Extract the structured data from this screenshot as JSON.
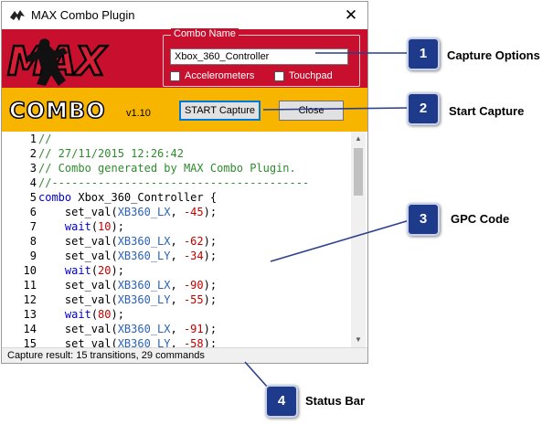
{
  "window": {
    "title": "MAX Combo Plugin",
    "close_glyph": "✕",
    "icon": "app-icon"
  },
  "header": {
    "logo_text": "MAX",
    "combo_name_legend": "Combo Name",
    "combo_name_value": "Xbox_360_Controller",
    "accelerometers_label": "Accelerometers",
    "touchpad_label": "Touchpad"
  },
  "toolbar": {
    "combo_logo_text": "COMBO",
    "version": "v1.10",
    "start_capture_label": "START Capture",
    "close_label": "Close"
  },
  "code": {
    "lines": [
      {
        "n": "1",
        "parts": [
          {
            "t": "//",
            "c": "comment"
          }
        ]
      },
      {
        "n": "2",
        "parts": [
          {
            "t": "// 27/11/2015 12:26:42",
            "c": "comment"
          }
        ]
      },
      {
        "n": "3",
        "parts": [
          {
            "t": "// Combo generated by MAX Combo Plugin.",
            "c": "comment"
          }
        ]
      },
      {
        "n": "4",
        "parts": [
          {
            "t": "//---------------------------------------",
            "c": "comment"
          }
        ]
      },
      {
        "n": "5",
        "parts": [
          {
            "t": "combo",
            "c": "kw"
          },
          {
            "t": " Xbox_360_Controller {",
            "c": "plain"
          }
        ]
      },
      {
        "n": "6",
        "parts": [
          {
            "t": "    set_val(",
            "c": "plain"
          },
          {
            "t": "XB360_LX",
            "c": "const"
          },
          {
            "t": ", ",
            "c": "plain"
          },
          {
            "t": "-45",
            "c": "num"
          },
          {
            "t": ");",
            "c": "plain"
          }
        ]
      },
      {
        "n": "7",
        "parts": [
          {
            "t": "    ",
            "c": "plain"
          },
          {
            "t": "wait",
            "c": "kw"
          },
          {
            "t": "(",
            "c": "plain"
          },
          {
            "t": "10",
            "c": "num"
          },
          {
            "t": ");",
            "c": "plain"
          }
        ]
      },
      {
        "n": "8",
        "parts": [
          {
            "t": "    set_val(",
            "c": "plain"
          },
          {
            "t": "XB360_LX",
            "c": "const"
          },
          {
            "t": ", ",
            "c": "plain"
          },
          {
            "t": "-62",
            "c": "num"
          },
          {
            "t": ");",
            "c": "plain"
          }
        ]
      },
      {
        "n": "9",
        "parts": [
          {
            "t": "    set_val(",
            "c": "plain"
          },
          {
            "t": "XB360_LY",
            "c": "const"
          },
          {
            "t": ", ",
            "c": "plain"
          },
          {
            "t": "-34",
            "c": "num"
          },
          {
            "t": ");",
            "c": "plain"
          }
        ]
      },
      {
        "n": "10",
        "parts": [
          {
            "t": "    ",
            "c": "plain"
          },
          {
            "t": "wait",
            "c": "kw"
          },
          {
            "t": "(",
            "c": "plain"
          },
          {
            "t": "20",
            "c": "num"
          },
          {
            "t": ");",
            "c": "plain"
          }
        ]
      },
      {
        "n": "11",
        "parts": [
          {
            "t": "    set_val(",
            "c": "plain"
          },
          {
            "t": "XB360_LX",
            "c": "const"
          },
          {
            "t": ", ",
            "c": "plain"
          },
          {
            "t": "-90",
            "c": "num"
          },
          {
            "t": ");",
            "c": "plain"
          }
        ]
      },
      {
        "n": "12",
        "parts": [
          {
            "t": "    set_val(",
            "c": "plain"
          },
          {
            "t": "XB360_LY",
            "c": "const"
          },
          {
            "t": ", ",
            "c": "plain"
          },
          {
            "t": "-55",
            "c": "num"
          },
          {
            "t": ");",
            "c": "plain"
          }
        ]
      },
      {
        "n": "13",
        "parts": [
          {
            "t": "    ",
            "c": "plain"
          },
          {
            "t": "wait",
            "c": "kw"
          },
          {
            "t": "(",
            "c": "plain"
          },
          {
            "t": "80",
            "c": "num"
          },
          {
            "t": ");",
            "c": "plain"
          }
        ]
      },
      {
        "n": "14",
        "parts": [
          {
            "t": "    set_val(",
            "c": "plain"
          },
          {
            "t": "XB360_LX",
            "c": "const"
          },
          {
            "t": ", ",
            "c": "plain"
          },
          {
            "t": "-91",
            "c": "num"
          },
          {
            "t": ");",
            "c": "plain"
          }
        ]
      },
      {
        "n": "15",
        "parts": [
          {
            "t": "    set_val(",
            "c": "plain"
          },
          {
            "t": "XB360_LY",
            "c": "const"
          },
          {
            "t": ", ",
            "c": "plain"
          },
          {
            "t": "-58",
            "c": "num"
          },
          {
            "t": ");",
            "c": "plain"
          }
        ]
      }
    ]
  },
  "status_bar": {
    "text": "Capture result: 15 transitions, 29 commands"
  },
  "callouts": [
    {
      "number": "1",
      "label": "Capture Options"
    },
    {
      "number": "2",
      "label": "Start Capture"
    },
    {
      "number": "3",
      "label": "GPC Code"
    },
    {
      "number": "4",
      "label": "Status Bar"
    }
  ],
  "colors": {
    "header_red": "#c8102e",
    "band_yellow": "#f7b500",
    "callout_blue": "#1e3a8a",
    "comment_green": "#2e8b2e",
    "keyword_blue": "#0000cc"
  }
}
